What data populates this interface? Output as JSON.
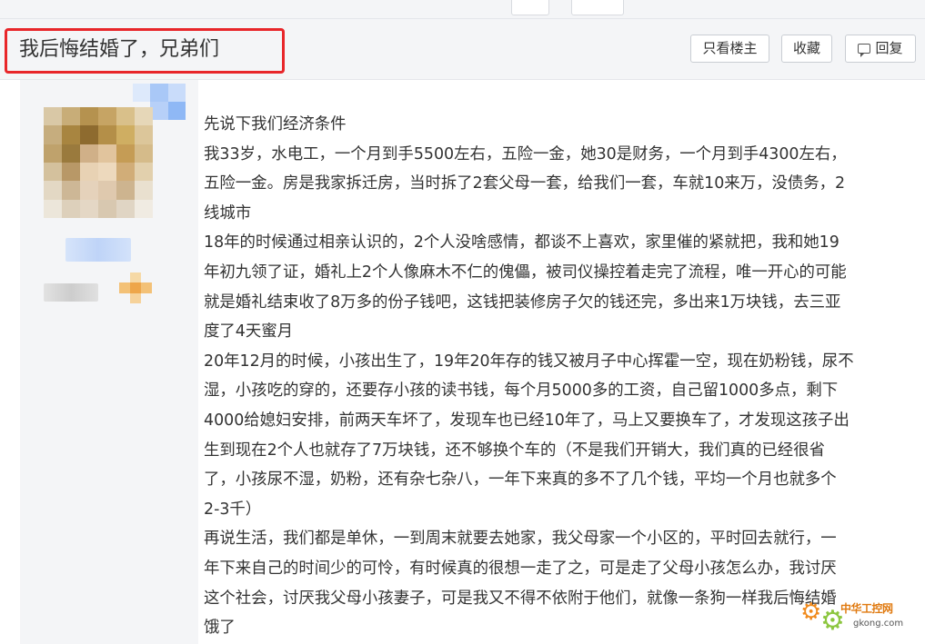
{
  "thread": {
    "title": "我后悔结婚了，兄弟们"
  },
  "toolbar": {
    "only_op_label": "只看楼主",
    "favorite_label": "收藏",
    "reply_label": "回复"
  },
  "post": {
    "lines": [
      "先说下我们经济条件",
      "我33岁，水电工，一个月到手5500左右，五险一金，她30是财务，一个月到手4300左右，",
      "五险一金。房是我家拆迁房，当时拆了2套父母一套，给我们一套，车就10来万，没债务，2",
      "线城市",
      "18年的时候通过相亲认识的，2个人没啥感情，都谈不上喜欢，家里催的紧就把，我和她19",
      "年初九领了证，婚礼上2个人像麻木不仁的傀儡，被司仪操控着走完了流程，唯一开心的可能",
      "就是婚礼结束收了8万多的份子钱吧，这钱把装修房子欠的钱还完，多出来1万块钱，去三亚",
      "度了4天蜜月",
      "20年12月的时候，小孩出生了，19年20年存的钱又被月子中心挥霍一空，现在奶粉钱，尿不",
      "湿，小孩吃的穿的，还要存小孩的读书钱，每个月5000多的工资，自己留1000多点，剩下",
      "4000给媳妇安排，前两天车坏了，发现车也已经10年了，马上又要换车了，才发现这孩子出",
      "生到现在2个人也就存了7万块钱，还不够换个车的（不是我们开销大，我们真的已经很省",
      "了，小孩尿不湿，奶粉，还有杂七杂八，一年下来真的多不了几个钱，平均一个月也就多个",
      "2-3千）",
      "再说生活，我们都是单休，一到周末就要去她家，我父母家一个小区的，平时回去就行，一",
      "年下来自己的时间少的可怜，有时候真的很想一走了之，可是走了父母小孩怎么办，我讨厌",
      "这个社会，讨厌我父母小孩妻子，可是我又不得不依附于他们，就像一条狗一样我后悔结婚",
      "饿了"
    ]
  },
  "watermark": {
    "text": "中华工控网",
    "url": "gkong.com"
  },
  "colors": {
    "highlight_border": "#e8262a",
    "panel_bg": "#f4f5f7",
    "text": "#333333",
    "watermark_orange": "#e07a10"
  }
}
